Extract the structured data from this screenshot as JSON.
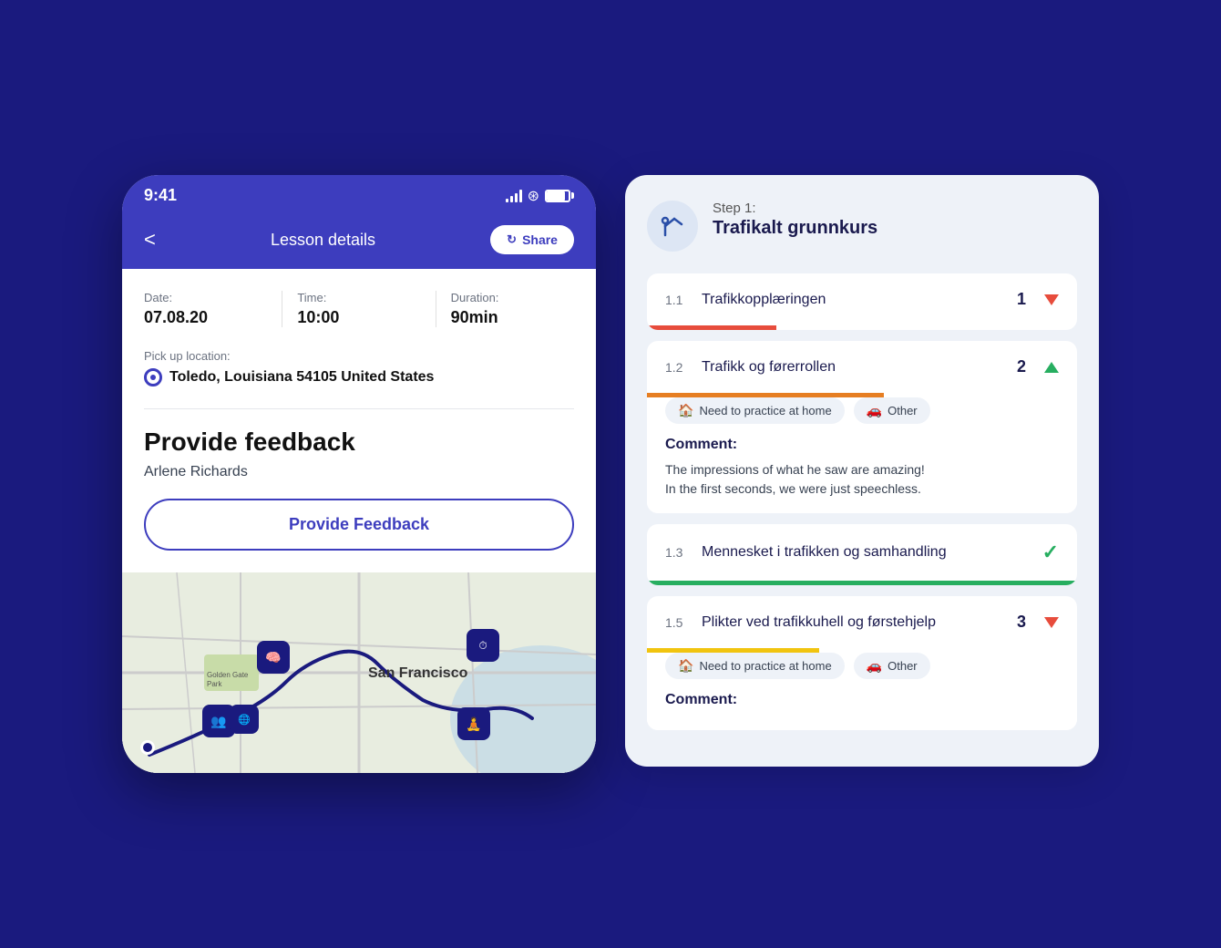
{
  "left_phone": {
    "status_bar": {
      "time": "9:41"
    },
    "nav": {
      "title": "Lesson details",
      "share_label": "Share",
      "back_arrow": "<"
    },
    "lesson": {
      "date_label": "Date:",
      "date_value": "07.08.20",
      "time_label": "Time:",
      "time_value": "10:00",
      "duration_label": "Duration:",
      "duration_value": "90min",
      "pickup_label": "Pick up location:",
      "pickup_value": "Toledo, Louisiana 54105 United States"
    },
    "feedback": {
      "title": "Provide feedback",
      "name": "Arlene Richards",
      "button_label": "Provide Feedback"
    },
    "map": {
      "city_label": "San Francisco"
    }
  },
  "right_panel": {
    "step_label": "Step 1:",
    "course_title": "Trafikalt grunnkurs",
    "lessons": [
      {
        "num": "1.1",
        "title": "Trafikkopplæringen",
        "score": "1",
        "indicator": "arrow-down",
        "progress": "red",
        "expanded": false
      },
      {
        "num": "1.2",
        "title": "Trafikk og førerrollen",
        "score": "2",
        "indicator": "arrow-up",
        "progress": "orange",
        "expanded": true,
        "tags": [
          "Need to practice at home",
          "Other"
        ],
        "tag_icons": [
          "🏠",
          "🚗"
        ],
        "comment_label": "Comment:",
        "comment_text": "The impressions of what he saw are amazing!\nIn the first seconds, we were just speechless."
      },
      {
        "num": "1.3",
        "title": "Mennesket i trafikken og samhandling",
        "score": "",
        "indicator": "check",
        "progress": "green",
        "expanded": false
      },
      {
        "num": "1.5",
        "title": "Plikter ved trafikkuhell og førstehjelp",
        "score": "3",
        "indicator": "arrow-down",
        "progress": "yellow",
        "expanded": true,
        "tags": [
          "Need to practice at home",
          "Other"
        ],
        "tag_icons": [
          "🏠",
          "🚗"
        ],
        "comment_label": "Comment:",
        "comment_text": ""
      }
    ]
  }
}
